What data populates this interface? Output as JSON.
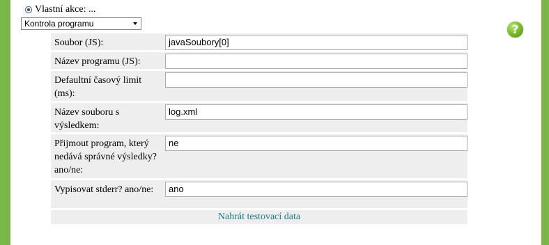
{
  "radio": {
    "label": "Vlastní akce: ...",
    "selected": true
  },
  "select": {
    "value": "Kontrola programu"
  },
  "help": {
    "glyph": "?",
    "icon": "help-icon",
    "color": "#7cbf2d"
  },
  "rows": [
    {
      "label": "Soubor (JS):",
      "value": "javaSoubory[0]"
    },
    {
      "label": "Název programu (JS):",
      "value": ""
    },
    {
      "label": "Defaultní časový limit (ms):",
      "value": ""
    },
    {
      "label": "Název souboru s výsledkem:",
      "value": "log.xml"
    },
    {
      "label": "Přijmout program, který nedává správné výsledky? ano/ne:",
      "value": "ne"
    },
    {
      "label": "Vypisovat stderr? ano/ne:",
      "value": "ano"
    }
  ],
  "action": {
    "label": "Nahrát testovací data"
  },
  "colors": {
    "accent": "#7ab648",
    "link": "#1a7a86",
    "row_bg": "#eeeeee"
  }
}
